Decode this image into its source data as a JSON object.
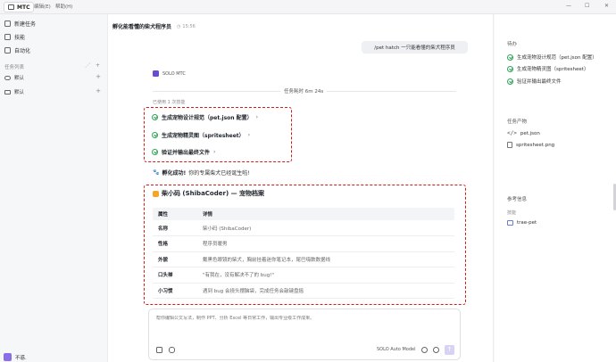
{
  "topbar": {
    "app_name": "MTC",
    "menu1": "编辑(E)",
    "menu2": "帮助(H)",
    "min": "—",
    "max": "☐",
    "close": "✕"
  },
  "sidebar": {
    "nav": [
      {
        "label": "新建任务",
        "icon": "new-task-icon"
      },
      {
        "label": "技能",
        "icon": "skill-icon"
      },
      {
        "label": "自动化",
        "icon": "automation-icon"
      }
    ],
    "section_title": "任务列表",
    "tasks": [
      {
        "label": "默认",
        "icon": "cloud-icon"
      },
      {
        "label": "默认",
        "icon": "folder-icon"
      }
    ],
    "user_name": "不惑."
  },
  "main": {
    "title": "孵化能看懂的柴犬程序员",
    "time": "15:56",
    "user_message": "/pet hatch 一只能看懂的柴犬程序员",
    "agent_name": "SOLO MTC",
    "duration": "任务耗时 6m 24s",
    "used_skills": "已使用 1 次技能",
    "steps": [
      "生成宠物设计规范（pet.json 配置）",
      "生成宠物精灵图（spritesheet）",
      "验证并输出最终文件"
    ],
    "success_bold": "孵化成功!",
    "success_rest": "你的专属柴犬已经诞生啦!",
    "profile_title": "柴小码 (ShibaCoder) — 宠物档案",
    "table_headers": [
      "属性",
      "详情"
    ],
    "table_rows": [
      [
        "名称",
        "柴小码 (ShibaCoder)"
      ],
      [
        "性格",
        "程序员暖男"
      ],
      [
        "外貌",
        "戴黑色眼镜的柴犬，胸前挂着迷你笔记本，尾巴嗨数数据线"
      ],
      [
        "口头禅",
        "\"有我在，没有解决不了的 bug!\""
      ],
      [
        "小习惯",
        "遇到 bug 会挠头摆脑袋，完成任务会敲键盘摇"
      ]
    ],
    "input_placeholder": "帮你编辑公文写法，制作 PPT、分析 Excel 等日常工作，输出专业级工作成果。",
    "model": "SOLO Auto Model",
    "send": "↑"
  },
  "right": {
    "todo_title": "待办",
    "todos": [
      "生成宠物设计规范（pet.json 配置）",
      "生成宠物精灵图（spritesheet）",
      "验证并输出最终文件"
    ],
    "products_title": "任务产物",
    "products": [
      "pet.json",
      "spritesheet.png"
    ],
    "ref_title": "参考信息",
    "skills_title": "技能",
    "skill": "trae-pet"
  }
}
